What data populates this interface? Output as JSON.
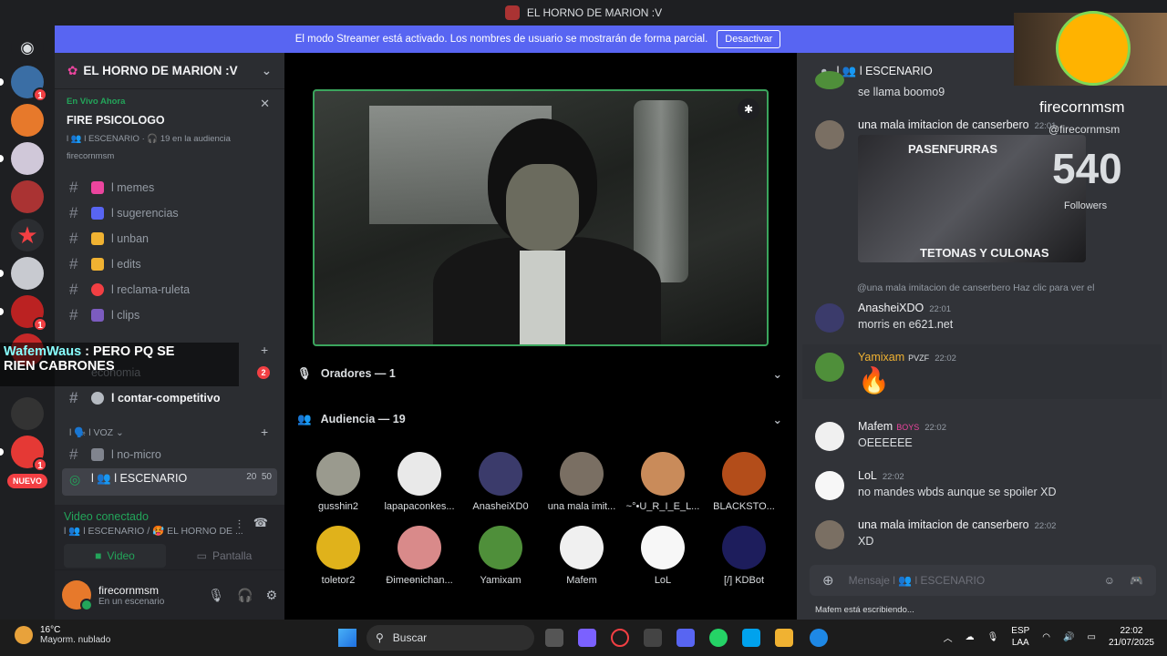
{
  "window": {
    "title": "EL HORNO DE MARION :V"
  },
  "streamer_bar": {
    "text": "El modo Streamer está activado. Los nombres de usuario se mostrarán de forma parcial.",
    "button": "Desactivar"
  },
  "guilds": {
    "new_label": "NUEVO",
    "badge_1": "1",
    "badge_2": "1",
    "badge_3": "1"
  },
  "server": {
    "name": "EL HORNO DE MARION :V"
  },
  "live": {
    "label": "En Vivo Ahora",
    "title": "FIRE PSICOLOGO",
    "sub": "l 👥 l ESCENARIO · 🎧 19 en la audiencia",
    "user": "firecornmsm"
  },
  "channels": [
    {
      "name": "l memes"
    },
    {
      "name": "l sugerencias"
    },
    {
      "name": "l unban"
    },
    {
      "name": "l edits"
    },
    {
      "name": "l reclama-ruleta"
    },
    {
      "name": "l clips"
    },
    {
      "name": "economia",
      "mention": "2"
    },
    {
      "name": "l contar-competitivo"
    }
  ],
  "category_voice": "l 🗣️ l VOZ ⌄",
  "voice_channels": [
    {
      "name": "l no-micro"
    },
    {
      "name": "l 👥 l ESCENARIO",
      "count": "20",
      "limit": "50",
      "sub": "FIRE PSICOLOGO"
    }
  ],
  "overlay_chat": {
    "user": "WafemWaus",
    "line1": ": PERO PQ SE",
    "line2": "RIEN CABRONES"
  },
  "voice_panel": {
    "status": "Video conectado",
    "channel": "l 👥 l ESCENARIO / 🥵 EL HORNO DE ...",
    "video_btn": "Video",
    "screen_btn": "Pantalla"
  },
  "user_panel": {
    "name": "firecornmsm",
    "status": "En un escenario"
  },
  "stage": {
    "speakers": "Oradores — 1",
    "audience": "Audiencia — 19",
    "members": [
      {
        "name": "gusshin2",
        "color": "#9a9a8e"
      },
      {
        "name": "lapapaconkes...",
        "color": "#e9e9e9"
      },
      {
        "name": "AnasheiXD0",
        "color": "#3b3b6b"
      },
      {
        "name": "una mala imit...",
        "color": "#7a6f63"
      },
      {
        "name": "~°•U_R_I_E_L...",
        "color": "#c98b5a"
      },
      {
        "name": "BLACKSTO...",
        "color": "#b34d1a"
      },
      {
        "name": "toletor2",
        "color": "#e0b21b"
      },
      {
        "name": "Ðimeɵnichan...",
        "color": "#d98a8a"
      },
      {
        "name": "Yamixam",
        "color": "#4f8f3a"
      },
      {
        "name": "Mafem",
        "color": "#f0f0f0"
      },
      {
        "name": "LoL",
        "color": "#f7f7f7"
      },
      {
        "name": "[/] KDBot",
        "color": "#1d1d5c"
      }
    ]
  },
  "chat": {
    "channel": "l 👥 l ESCENARIO",
    "messages": [
      {
        "text_top": "se llama boomo9"
      },
      {
        "author": "una mala imitacion de canserbero",
        "time": "22:01"
      },
      {
        "embed_top": "PASENFURRAS",
        "embed_bottom": "TETONAS Y CULONAS"
      },
      {
        "reply": "@una mala imitacion de canserbero Haz clic para ver el"
      },
      {
        "author": "AnasheiXDO",
        "time": "22:01",
        "text": "morris en e621.net"
      },
      {
        "author": "Yamixam",
        "tag": "PVZF",
        "time": "22:02",
        "text": "🔥"
      },
      {
        "author": "Mafem",
        "tag": "BOYS",
        "time": "22:02",
        "text": "OEEEEEE"
      },
      {
        "author": "LoL",
        "time": "22:02",
        "text": "no mandes wbds aunque se spoiler XD"
      },
      {
        "author": "una mala imitacion de canserbero",
        "time": "22:02",
        "text": "XD"
      }
    ],
    "input_placeholder": "Mensaje  l 👥 l ESCENARIO",
    "typing": "Mafem está escribiendo..."
  },
  "stream_overlay": {
    "name": "firecornmsm",
    "handle": "@firecornmsm",
    "count": "540",
    "label": "Followers"
  },
  "taskbar": {
    "temp": "16°C",
    "weather": "Mayorm. nublado",
    "search": "Buscar",
    "lang1": "ESP",
    "lang2": "LAA",
    "time": "22:02",
    "date": "21/07/2025"
  },
  "colors": {
    "accent": "#5865f2",
    "online": "#23a55a",
    "danger": "#f23f43"
  }
}
